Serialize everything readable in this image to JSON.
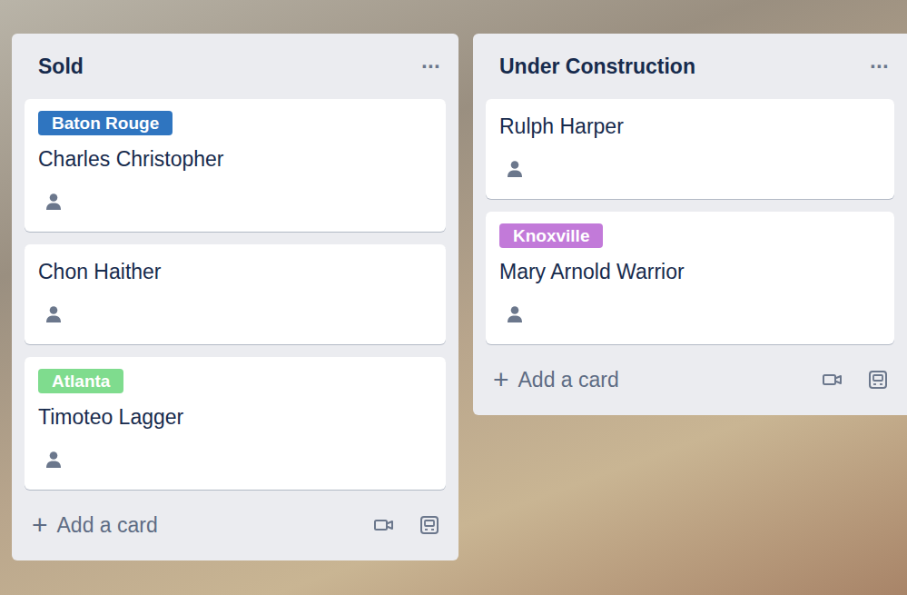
{
  "board": {
    "lists": [
      {
        "title": "Sold",
        "menu": "···",
        "add_icon": "+",
        "add_label": "Add a card",
        "cards": [
          {
            "labels": [
              {
                "text": "Baton Rouge",
                "color": "#2f75c0"
              }
            ],
            "name": "Charles Christopher"
          },
          {
            "labels": [],
            "name": "Chon Haither"
          },
          {
            "labels": [
              {
                "text": "Atlanta",
                "color": "#7fdc8e"
              }
            ],
            "name": "Timoteo Lagger"
          }
        ]
      },
      {
        "title": "Under Construction",
        "menu": "···",
        "add_icon": "+",
        "add_label": "Add a card",
        "cards": [
          {
            "labels": [],
            "name": "Rulph Harper"
          },
          {
            "labels": [
              {
                "text": "Knoxville",
                "color": "#c27ad9"
              }
            ],
            "name": "Mary Arnold Warrior"
          }
        ]
      }
    ]
  }
}
